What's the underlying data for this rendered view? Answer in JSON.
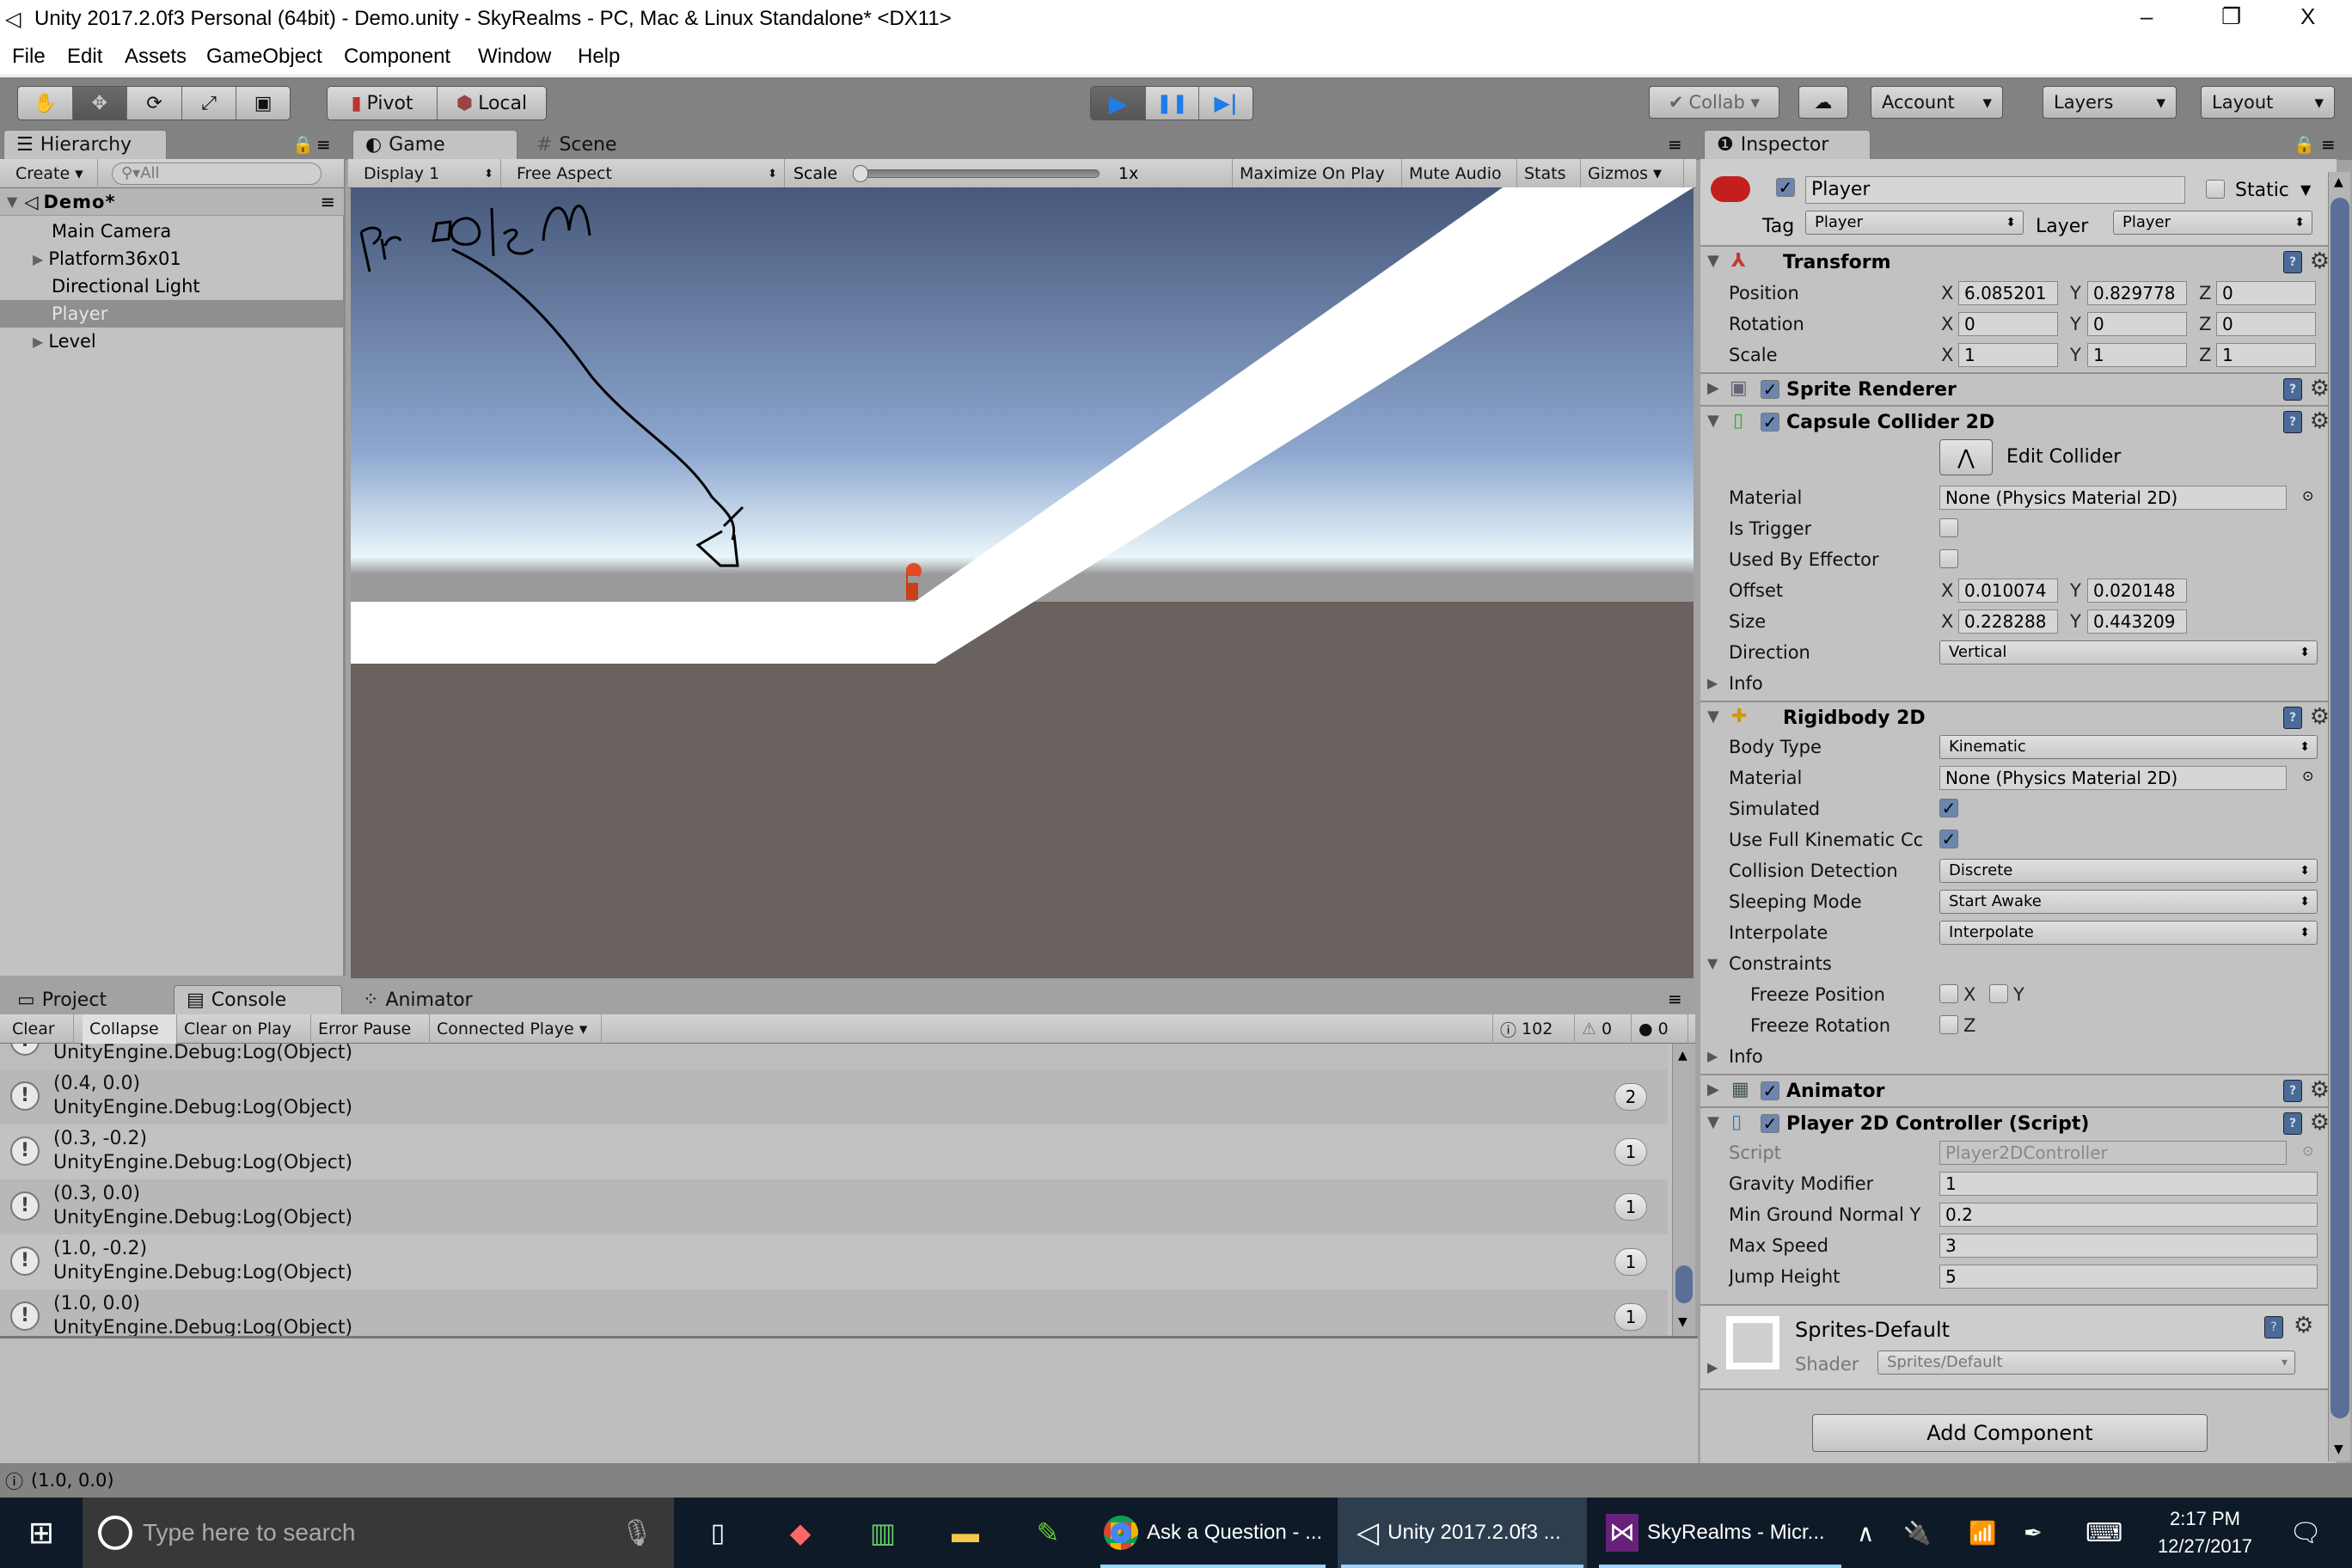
{
  "window": {
    "title": "Unity 2017.2.0f3 Personal (64bit) - Demo.unity - SkyRealms - PC, Mac & Linux Standalone* <DX11>",
    "controls": {
      "minimize": "–",
      "restore": "❐",
      "close": "X"
    }
  },
  "menu": [
    "File",
    "Edit",
    "Assets",
    "GameObject",
    "Component",
    "Window",
    "Help"
  ],
  "toolbar": {
    "tools": [
      "hand-tool",
      "move-tool",
      "rotate-tool",
      "scale-tool",
      "rect-tool"
    ],
    "tool_glyphs": [
      "✋",
      "✥",
      "⟳",
      "⤢",
      "▣"
    ],
    "pivot": "Pivot",
    "local": "Local",
    "play_glyphs": {
      "play": "▶",
      "pause": "❚❚",
      "step": "▶|"
    },
    "collab": "Collab ▾",
    "cloud": "☁",
    "account": "Account",
    "layers": "Layers",
    "layout": "Layout",
    "dropdown_arrow": "▾"
  },
  "hierarchy": {
    "tab": "Hierarchy",
    "create": "Create ▾",
    "search_placeholder": "All",
    "scene": "Demo*",
    "items": [
      {
        "label": "Main Camera",
        "expandable": false,
        "selected": false
      },
      {
        "label": "Platform36x01",
        "expandable": true,
        "selected": false
      },
      {
        "label": "Directional Light",
        "expandable": false,
        "selected": false
      },
      {
        "label": "Player",
        "expandable": false,
        "selected": true
      },
      {
        "label": "Level",
        "expandable": true,
        "selected": false
      }
    ]
  },
  "game": {
    "tabs": [
      {
        "label": "Game",
        "icon": "◐"
      },
      {
        "label": "Scene",
        "icon": "#"
      }
    ],
    "display": "Display 1",
    "aspect": "Free Aspect",
    "scale_label": "Scale",
    "scale_value": "1x",
    "scale_fraction": 0.0,
    "buttons": [
      "Maximize On Play",
      "Mute Audio",
      "Stats",
      "Gizmos"
    ],
    "annotation": "Problem",
    "colors": {
      "sky_top": "#47587a",
      "sky_mid": "#8ea8d0",
      "horizon": "#eaf6fa",
      "ground": "#69625e",
      "platform": "#ffffff"
    }
  },
  "console": {
    "tabs": [
      "Project",
      "Console",
      "Animator"
    ],
    "buttons": [
      "Clear",
      "Collapse",
      "Clear on Play",
      "Error Pause",
      "Connected Playe ▾"
    ],
    "counts": {
      "log": "102",
      "warn": "0",
      "error": "0"
    },
    "entries": [
      {
        "line1": "",
        "line2": "UnityEngine.Debug:Log(Object)",
        "count": ""
      },
      {
        "line1": "(0.4, 0.0)",
        "line2": "UnityEngine.Debug:Log(Object)",
        "count": "2"
      },
      {
        "line1": "(0.3, -0.2)",
        "line2": "UnityEngine.Debug:Log(Object)",
        "count": "1"
      },
      {
        "line1": "(0.3, 0.0)",
        "line2": "UnityEngine.Debug:Log(Object)",
        "count": "1"
      },
      {
        "line1": "(1.0, -0.2)",
        "line2": "UnityEngine.Debug:Log(Object)",
        "count": "1"
      },
      {
        "line1": "(1.0, 0.0)",
        "line2": "UnityEngine.Debug:Log(Object)",
        "count": "1"
      }
    ],
    "status": "(1.0, 0.0)"
  },
  "inspector": {
    "tab": "Inspector",
    "object_name": "Player",
    "active": true,
    "static_label": "Static",
    "tag_label": "Tag",
    "tag": "Player",
    "layer_label": "Layer",
    "layer": "Player",
    "transform": {
      "title": "Transform",
      "rows": [
        {
          "label": "Position",
          "x": "6.085201",
          "y": "0.829778",
          "z": "0"
        },
        {
          "label": "Rotation",
          "x": "0",
          "y": "0",
          "z": "0"
        },
        {
          "label": "Scale",
          "x": "1",
          "y": "1",
          "z": "1"
        }
      ]
    },
    "sprite_renderer": {
      "title": "Sprite Renderer",
      "enabled": true
    },
    "capsule_collider": {
      "title": "Capsule Collider 2D",
      "enabled": true,
      "edit_collider": "Edit Collider",
      "material_label": "Material",
      "material": "None (Physics Material 2D)",
      "is_trigger_label": "Is Trigger",
      "is_trigger": false,
      "used_by_effector_label": "Used By Effector",
      "used_by_effector": false,
      "offset_label": "Offset",
      "offset_x": "0.010074",
      "offset_y": "0.020148",
      "size_label": "Size",
      "size_x": "0.228288",
      "size_y": "0.443209",
      "direction_label": "Direction",
      "direction": "Vertical",
      "info": "Info"
    },
    "rigidbody": {
      "title": "Rigidbody 2D",
      "body_type_label": "Body Type",
      "body_type": "Kinematic",
      "material_label": "Material",
      "material": "None (Physics Material 2D)",
      "simulated_label": "Simulated",
      "simulated": true,
      "full_kinematic_label": "Use Full Kinematic Cc",
      "full_kinematic": true,
      "collision_label": "Collision Detection",
      "collision": "Discrete",
      "sleeping_label": "Sleeping Mode",
      "sleeping": "Start Awake",
      "interpolate_label": "Interpolate",
      "interpolate": "Interpolate",
      "constraints": "Constraints",
      "freeze_pos_label": "Freeze Position",
      "freeze_rot_label": "Freeze Rotation",
      "info": "Info"
    },
    "animator": {
      "title": "Animator",
      "enabled": true
    },
    "controller": {
      "title": "Player 2D Controller (Script)",
      "enabled": true,
      "script_label": "Script",
      "script": "Player2DController",
      "gravity_label": "Gravity Modifier",
      "gravity": "1",
      "min_ground_label": "Min Ground Normal Y",
      "min_ground": "0.2",
      "max_speed_label": "Max Speed",
      "max_speed": "3",
      "jump_label": "Jump Height",
      "jump": "5"
    },
    "material": {
      "name": "Sprites-Default",
      "shader_label": "Shader",
      "shader": "Sprites/Default"
    },
    "add_component": "Add Component"
  },
  "taskbar": {
    "search_placeholder": "Type here to search",
    "apps": [
      {
        "label": "Ask a Question - ...",
        "icon": "chrome"
      },
      {
        "label": "Unity 2017.2.0f3 ...",
        "icon": "unity",
        "active": true
      },
      {
        "label": "SkyRealms - Micr...",
        "icon": "visual-studio"
      }
    ],
    "time": "2:17 PM",
    "date": "12/27/2017"
  }
}
